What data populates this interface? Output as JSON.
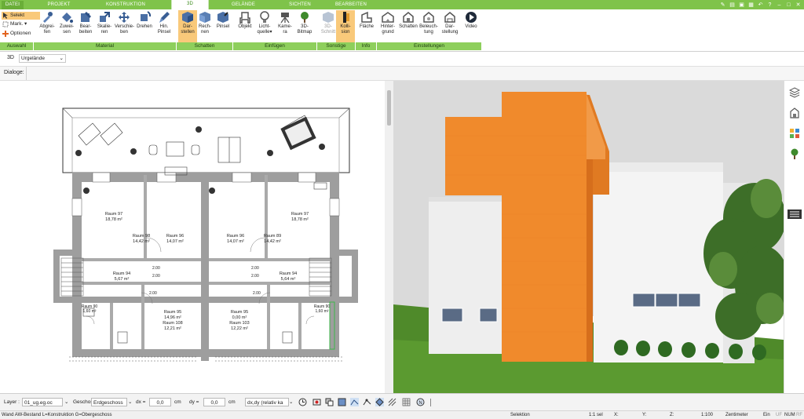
{
  "tabs": {
    "datei": "DATEI",
    "projekt": "PROJEKT",
    "konstruktion": "KONSTRUKTION",
    "d3": "3D",
    "gelaende": "GELÄNDE",
    "sichten": "SICHTEN",
    "bearbeiten": "BEARBEITEN"
  },
  "ribbon": {
    "auswahl": {
      "selekt": "Selekt",
      "mark": "Mark.",
      "optionen": "Optionen",
      "group": "Auswahl"
    },
    "material": {
      "group": "Material",
      "buttons": [
        "Abgrei-",
        "fen",
        "Zuwei-",
        "sen",
        "Bear-",
        "beiten",
        "Skalie-",
        "ren",
        "Verschie-",
        "ben",
        "Drehen",
        "",
        "Hin.",
        "Pinsel"
      ]
    },
    "schatten": {
      "group": "Schatten",
      "buttons": [
        "Dar-",
        "stellen",
        "Rech-",
        "nen",
        "Pinsel",
        ""
      ]
    },
    "einfuegen": {
      "group": "Einfügen",
      "buttons": [
        "Objekt",
        "",
        "Licht-",
        "quelle",
        "Kame-",
        "ra",
        "3D-",
        "Bitmap"
      ]
    },
    "sonstige": {
      "group": "Sonstige",
      "buttons": [
        "3D-",
        "Schnitt",
        "Kolli-",
        "sion"
      ]
    },
    "info": {
      "group": "Info",
      "buttons": [
        "Fläche",
        ""
      ]
    },
    "einstellungen": {
      "group": "Einstellungen",
      "buttons": [
        "Hinter-",
        "grund",
        "Schatten",
        "",
        "Beleuch-",
        "tung",
        "Dar-",
        "stellung",
        "Video",
        ""
      ]
    }
  },
  "view_row": {
    "label": "3D",
    "select": "Urgelände"
  },
  "dialog_row": {
    "label": "Dialoge:"
  },
  "rooms": [
    {
      "name": "Raum 97",
      "area": "18,78 m²"
    },
    {
      "name": "Raum 97",
      "area": "18,78 m²"
    },
    {
      "name": "Raum 98",
      "area": "14,42 m²"
    },
    {
      "name": "Raum 96",
      "area": "14,07 m²"
    },
    {
      "name": "Raum 96",
      "area": "14,07 m²"
    },
    {
      "name": "Raum 89",
      "area": "14,42 m²"
    },
    {
      "name": "Raum 94",
      "area": "5,67 m²"
    },
    {
      "name": "Raum 94",
      "area": "5,64 m²"
    },
    {
      "name": "Raum 95",
      "area": "14,96 m²"
    },
    {
      "name": "Raum 108",
      "area": "12,21 m²"
    },
    {
      "name": "Raum 95",
      "area": "0,00 m²"
    },
    {
      "name": "Raum 103",
      "area": "12,22 m²"
    },
    {
      "name": "Raum 90",
      "area": "1,60 m²"
    },
    {
      "name": "Raum 90",
      "area": "1,60 m²"
    }
  ],
  "dims": [
    "2.00",
    "2.00",
    "2.00",
    "2.00",
    "2.00",
    "2.00"
  ],
  "bottom": {
    "layer_label": "Layer :",
    "layer_value": "01_ug.eg.oc",
    "geschoss_label": "Geschoss :",
    "geschoss_value": "Erdgeschoss",
    "dx_label": "dx =",
    "dx_value": "0,0",
    "dx_unit": "cm",
    "dy_label": "dy =",
    "dy_value": "0,0",
    "dy_unit": "cm",
    "mode_value": "dx,dy (relativ ka"
  },
  "status": {
    "left": "Wand AW-Bestand L=Konstruktion G=Obergeschoss",
    "selektion": "Selektion",
    "sel": "1:1 sel",
    "x": "X:",
    "y": "Y:",
    "z": "Z:",
    "scale": "1:100",
    "unit": "Zentimeter",
    "ein": "Ein",
    "uf": "UF",
    "num": "NUM",
    "rf": "RF"
  },
  "colors": {
    "accent": "#7fc34a",
    "group_bar": "#8ecf5c",
    "selected": "#f9c97a",
    "orange_wall": "#f08a2c",
    "lawn": "#4f8a2a",
    "sky": "#dcdcdc"
  }
}
